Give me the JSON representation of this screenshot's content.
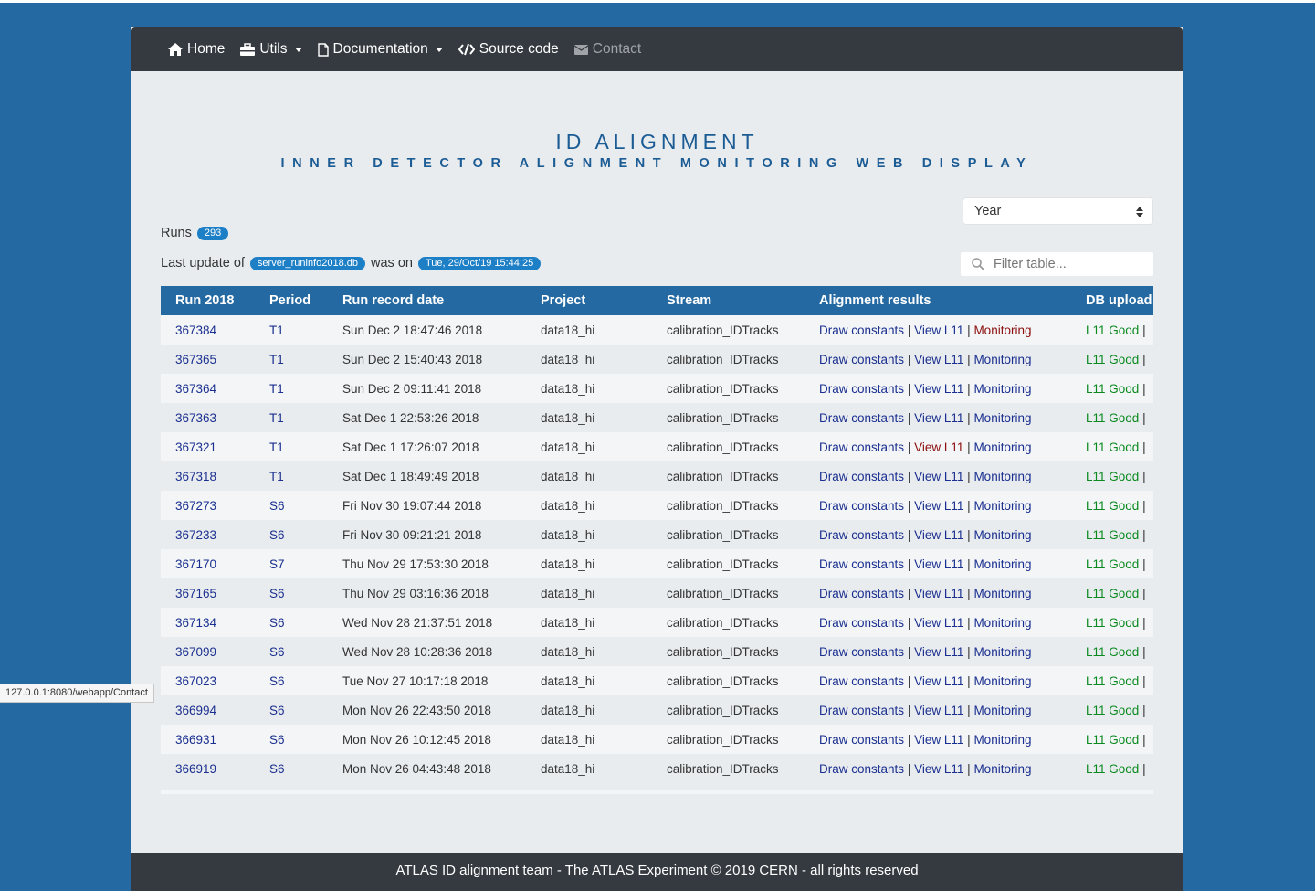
{
  "nav": {
    "home": "Home",
    "utils": "Utils",
    "documentation": "Documentation",
    "source": "Source code",
    "contact": "Contact"
  },
  "header": {
    "title": "ID ALIGNMENT",
    "subtitle": "INNER DETECTOR ALIGNMENT MONITORING WEB DISPLAY"
  },
  "controls": {
    "year_selected": "Year",
    "filter_placeholder": "Filter table..."
  },
  "summary": {
    "runs_label": "Runs",
    "runs_count": "293",
    "last_update_label": "Last update of",
    "db_file": "server_runinfo2018.db",
    "was_on_label": "was on",
    "update_time": "Tue, 29/Oct/19 15:44:25"
  },
  "table": {
    "headers": [
      "Run 2018",
      "Period",
      "Run record date",
      "Project",
      "Stream",
      "Alignment results",
      "DB upload"
    ],
    "link_labels": {
      "draw": "Draw constants",
      "view": "View L11",
      "monitoring": "Monitoring",
      "db": "L11 Good",
      "sep": "|"
    },
    "rows": [
      {
        "run": "367384",
        "period": "T1",
        "date": "Sun Dec 2 18:47:46 2018",
        "project": "data18_hi",
        "stream": "calibration_IDTracks"
      },
      {
        "run": "367365",
        "period": "T1",
        "date": "Sun Dec 2 15:40:43 2018",
        "project": "data18_hi",
        "stream": "calibration_IDTracks"
      },
      {
        "run": "367364",
        "period": "T1",
        "date": "Sun Dec 2 09:11:41 2018",
        "project": "data18_hi",
        "stream": "calibration_IDTracks"
      },
      {
        "run": "367363",
        "period": "T1",
        "date": "Sat Dec 1 22:53:26 2018",
        "project": "data18_hi",
        "stream": "calibration_IDTracks"
      },
      {
        "run": "367321",
        "period": "T1",
        "date": "Sat Dec 1 17:26:07 2018",
        "project": "data18_hi",
        "stream": "calibration_IDTracks"
      },
      {
        "run": "367318",
        "period": "T1",
        "date": "Sat Dec 1 18:49:49 2018",
        "project": "data18_hi",
        "stream": "calibration_IDTracks"
      },
      {
        "run": "367273",
        "period": "S6",
        "date": "Fri Nov 30 19:07:44 2018",
        "project": "data18_hi",
        "stream": "calibration_IDTracks"
      },
      {
        "run": "367233",
        "period": "S6",
        "date": "Fri Nov 30 09:21:21 2018",
        "project": "data18_hi",
        "stream": "calibration_IDTracks"
      },
      {
        "run": "367170",
        "period": "S7",
        "date": "Thu Nov 29 17:53:30 2018",
        "project": "data18_hi",
        "stream": "calibration_IDTracks"
      },
      {
        "run": "367165",
        "period": "S6",
        "date": "Thu Nov 29 03:16:36 2018",
        "project": "data18_hi",
        "stream": "calibration_IDTracks"
      },
      {
        "run": "367134",
        "period": "S6",
        "date": "Wed Nov 28 21:37:51 2018",
        "project": "data18_hi",
        "stream": "calibration_IDTracks"
      },
      {
        "run": "367099",
        "period": "S6",
        "date": "Wed Nov 28 10:28:36 2018",
        "project": "data18_hi",
        "stream": "calibration_IDTracks"
      },
      {
        "run": "367023",
        "period": "S6",
        "date": "Tue Nov 27 10:17:18 2018",
        "project": "data18_hi",
        "stream": "calibration_IDTracks"
      },
      {
        "run": "366994",
        "period": "S6",
        "date": "Mon Nov 26 22:43:50 2018",
        "project": "data18_hi",
        "stream": "calibration_IDTracks"
      },
      {
        "run": "366931",
        "period": "S6",
        "date": "Mon Nov 26 10:12:45 2018",
        "project": "data18_hi",
        "stream": "calibration_IDTracks"
      },
      {
        "run": "366919",
        "period": "S6",
        "date": "Mon Nov 26 04:43:48 2018",
        "project": "data18_hi",
        "stream": "calibration_IDTracks"
      }
    ]
  },
  "footer": {
    "text": "ATLAS ID alignment team - The ATLAS Experiment © 2019 CERN - all rights reserved"
  },
  "status_bar": {
    "url": "127.0.0.1:8080/webapp/Contact"
  },
  "colors": {
    "page_bg": "#2469a1",
    "navbar_bg": "#343a40",
    "title_color": "#1c5c95",
    "link_color": "#1a2f8f",
    "highlight_red": "#8b0e0e",
    "good_green": "#0a8a1f"
  }
}
